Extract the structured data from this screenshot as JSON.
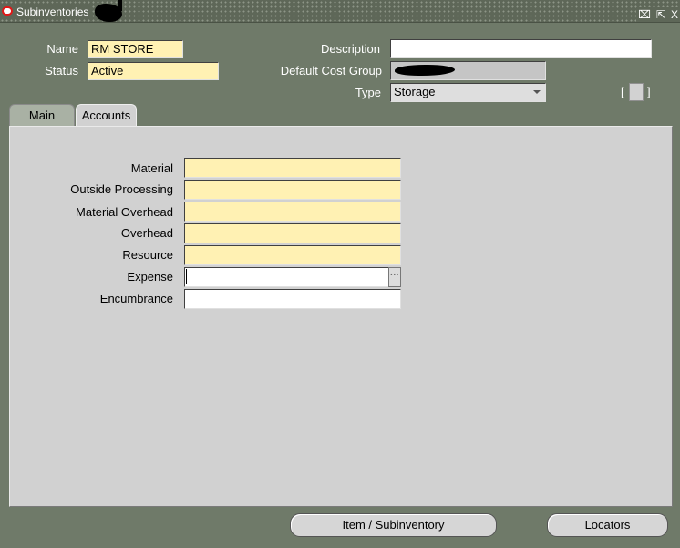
{
  "window": {
    "title": "Subinventories",
    "buttons": {
      "restore": "⌧",
      "maximize": "⇱",
      "close": "X"
    }
  },
  "header": {
    "name_label": "Name",
    "name_value": "RM STORE",
    "status_label": "Status",
    "status_value": "Active",
    "description_label": "Description",
    "description_value": "",
    "cost_group_label": "Default Cost Group",
    "type_label": "Type",
    "type_value": "Storage",
    "bracket_open": "[",
    "bracket_close": "]"
  },
  "tabs": [
    {
      "label": "Main",
      "active": false
    },
    {
      "label": "Accounts",
      "active": true
    }
  ],
  "accounts": {
    "material_label": "Material",
    "outside_processing_label": "Outside Processing",
    "material_overhead_label": "Material Overhead",
    "overhead_label": "Overhead",
    "resource_label": "Resource",
    "expense_label": "Expense",
    "encumbrance_label": "Encumbrance",
    "lov_button": "···"
  },
  "footer": {
    "item_subinventory_label": "Item / Subinventory",
    "locators_label": "Locators"
  },
  "colors": {
    "background": "#6f7a69",
    "required_field": "#fff1b3",
    "panel": "#d1d1d1"
  }
}
